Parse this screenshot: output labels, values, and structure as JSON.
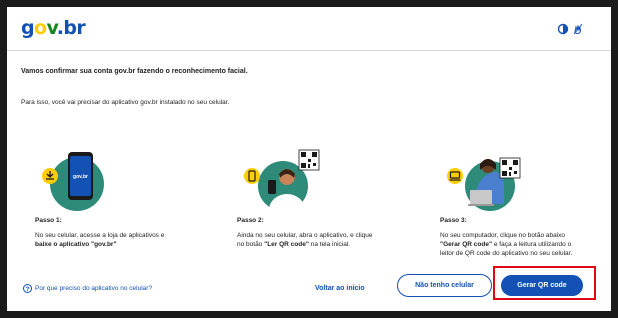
{
  "header": {
    "logo": {
      "g": "g",
      "o": "o",
      "v": "v",
      "dot": ".",
      "br": "br"
    },
    "icons": [
      "contrast-icon",
      "vlibras-hand-icon"
    ]
  },
  "intro": {
    "title": "Vamos confirmar sua conta gov.br fazendo o reconhecimento facial.",
    "subtitle": "Para isso, você vai precisar do aplicativo gov.br instalado no seu celular."
  },
  "steps": [
    {
      "title": "Passo 1:",
      "text_a": "No seu celular, acesse a loja de aplicativos e ",
      "text_bold": "baixe o aplicativo \"gov.br\"",
      "phone_label": "gov.br"
    },
    {
      "title": "Passo 2:",
      "text_a": "Ainda no seu celular, abra o aplicativo, e clique no botão ",
      "text_bold": "\"Ler QR code\"",
      "text_b": " na tela inicial."
    },
    {
      "title": "Passo 3:",
      "text_a": "No seu computador, clique no botão abaixo ",
      "text_bold": "\"Gerar QR code\"",
      "text_b": " e faça a leitura utilizando o leitor de QR code do aplicativo no seu celular."
    }
  ],
  "footer": {
    "help_link": "Por que preciso do aplicativo no celular?",
    "back_button": "Voltar ao início",
    "no_phone_button": "Não tenho celular",
    "generate_qr_button": "Gerar QR code"
  },
  "colors": {
    "brand_blue": "#1351b4",
    "brand_yellow": "#ffcd07",
    "brand_green": "#168821",
    "illustration_teal": "#2e8b7a",
    "highlight_red": "#e30613"
  }
}
